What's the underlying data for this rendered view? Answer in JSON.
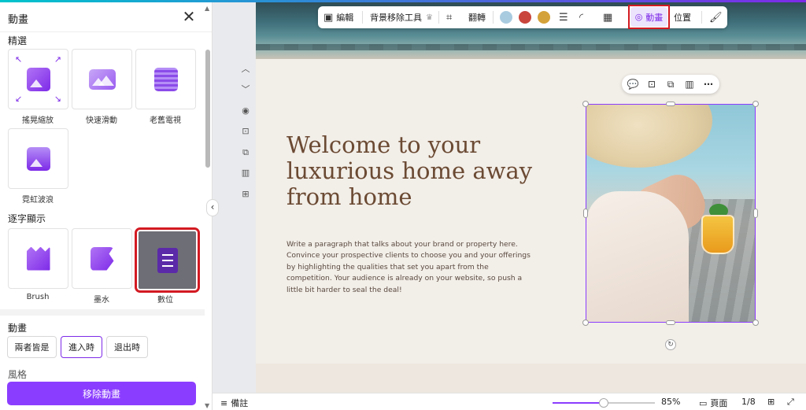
{
  "panel": {
    "title": "動畫",
    "sections": {
      "featured": "精選",
      "typing": "逐字顯示",
      "animate": "動畫",
      "style": "風格"
    },
    "featured_effects": [
      {
        "label": "搖晃縮放",
        "icon": "zoom-wiggle-icon"
      },
      {
        "label": "快速滑動",
        "icon": "fast-slide-icon"
      },
      {
        "label": "老舊電視",
        "icon": "old-tv-icon"
      },
      {
        "label": "霓虹波浪",
        "icon": "neon-wave-icon"
      }
    ],
    "typing_effects": [
      {
        "label": "Brush",
        "icon": "brush-icon"
      },
      {
        "label": "墨水",
        "icon": "ink-icon"
      },
      {
        "label": "數位",
        "icon": "digital-icon",
        "selected": true
      }
    ],
    "animate_options": [
      "兩者皆是",
      "進入時",
      "退出時"
    ],
    "animate_selected": "進入時",
    "remove_button": "移除動畫"
  },
  "toolbar": {
    "edit": "編輯",
    "bg_remover": "背景移除工具",
    "flip": "翻轉",
    "animate": "動畫",
    "position": "位置",
    "swatches": [
      "#a9cbe0",
      "#c9463d",
      "#d4a23a"
    ]
  },
  "canvas": {
    "headline": "Welcome to your luxurious home away from home",
    "paragraph": "Write a paragraph that talks about your brand or property here. Convince your prospective clients to choose you and your offerings by highlighting the qualities that set you apart from the competition. Your audience is already on your website, so push a little bit harder to seal the deal!"
  },
  "status": {
    "notes": "備註",
    "zoom": "85%",
    "zoom_level": 0.5,
    "pages_label": "頁面",
    "page_count": "1/8"
  },
  "colors": {
    "accent": "#8b3dff",
    "highlight": "#d31a22",
    "headline": "#6b4a33"
  }
}
